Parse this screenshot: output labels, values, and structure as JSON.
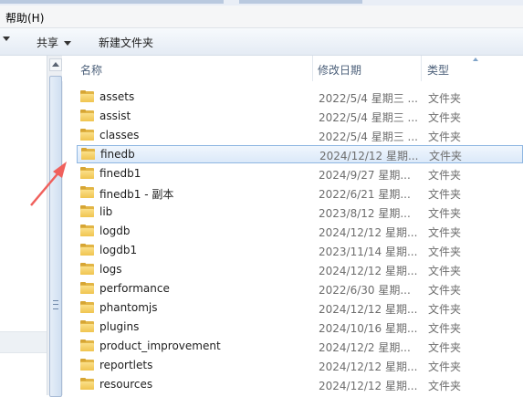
{
  "menu": {
    "help_label": "帮助(H)"
  },
  "toolbar": {
    "share_label": "共享",
    "new_folder_label": "新建文件夹"
  },
  "columns": {
    "name": "名称",
    "date": "修改日期",
    "type": "类型"
  },
  "files": [
    {
      "name": "assets",
      "date": "2022/5/4 星期三 ...",
      "type": "文件夹"
    },
    {
      "name": "assist",
      "date": "2022/5/4 星期三 ...",
      "type": "文件夹"
    },
    {
      "name": "classes",
      "date": "2022/5/4 星期三 ...",
      "type": "文件夹"
    },
    {
      "name": "finedb",
      "date": "2024/12/12 星期...",
      "type": "文件夹"
    },
    {
      "name": "finedb1",
      "date": "2024/9/27 星期...",
      "type": "文件夹"
    },
    {
      "name": "finedb1 - 副本",
      "date": "2022/6/21 星期...",
      "type": "文件夹"
    },
    {
      "name": "lib",
      "date": "2023/8/12 星期...",
      "type": "文件夹"
    },
    {
      "name": "logdb",
      "date": "2024/12/12 星期...",
      "type": "文件夹"
    },
    {
      "name": "logdb1",
      "date": "2023/11/14 星期...",
      "type": "文件夹"
    },
    {
      "name": "logs",
      "date": "2024/12/12 星期...",
      "type": "文件夹"
    },
    {
      "name": "performance",
      "date": "2022/6/30 星期...",
      "type": "文件夹"
    },
    {
      "name": "phantomjs",
      "date": "2024/12/12 星期...",
      "type": "文件夹"
    },
    {
      "name": "plugins",
      "date": "2024/10/16 星期...",
      "type": "文件夹"
    },
    {
      "name": "product_improvement",
      "date": "2024/12/2 星期...",
      "type": "文件夹"
    },
    {
      "name": "reportlets",
      "date": "2024/12/12 星期...",
      "type": "文件夹"
    },
    {
      "name": "resources",
      "date": "2024/12/12 星期...",
      "type": "文件夹"
    }
  ],
  "selected_file": "finedb",
  "annotation_color": "#f0605c",
  "folder_color": "#f0c44f"
}
